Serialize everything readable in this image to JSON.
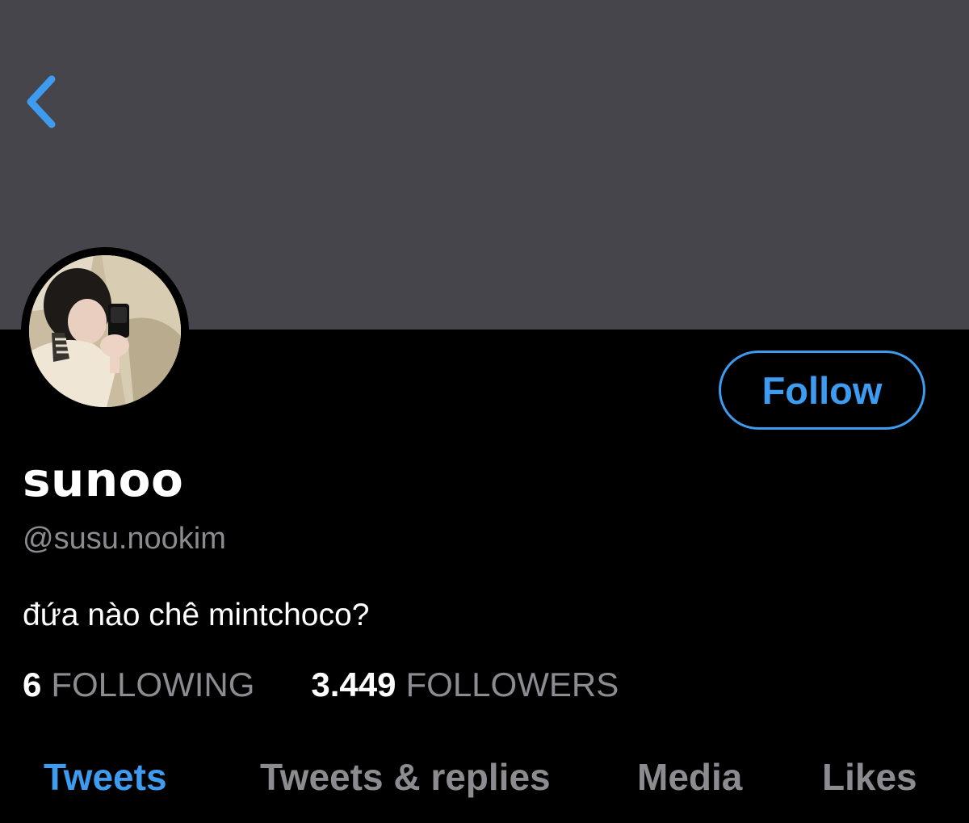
{
  "colors": {
    "accent": "#3d9bf0",
    "banner": "#46454b",
    "background": "#000000",
    "muted_text": "#8b8b90",
    "primary_text": "#ffffff"
  },
  "header": {
    "back_icon": "chevron-left-icon"
  },
  "profile": {
    "display_name": "sunoo",
    "handle": "@susu.nookim",
    "bio": "đứa nào chê mintchoco?",
    "follow_label": "Follow",
    "following_count": "6",
    "following_label": "FOLLOWING",
    "followers_count": "3.449",
    "followers_label": "FOLLOWERS"
  },
  "tabs": [
    {
      "label": "Tweets",
      "active": true
    },
    {
      "label": "Tweets & replies",
      "active": false
    },
    {
      "label": "Media",
      "active": false
    },
    {
      "label": "Likes",
      "active": false
    }
  ]
}
